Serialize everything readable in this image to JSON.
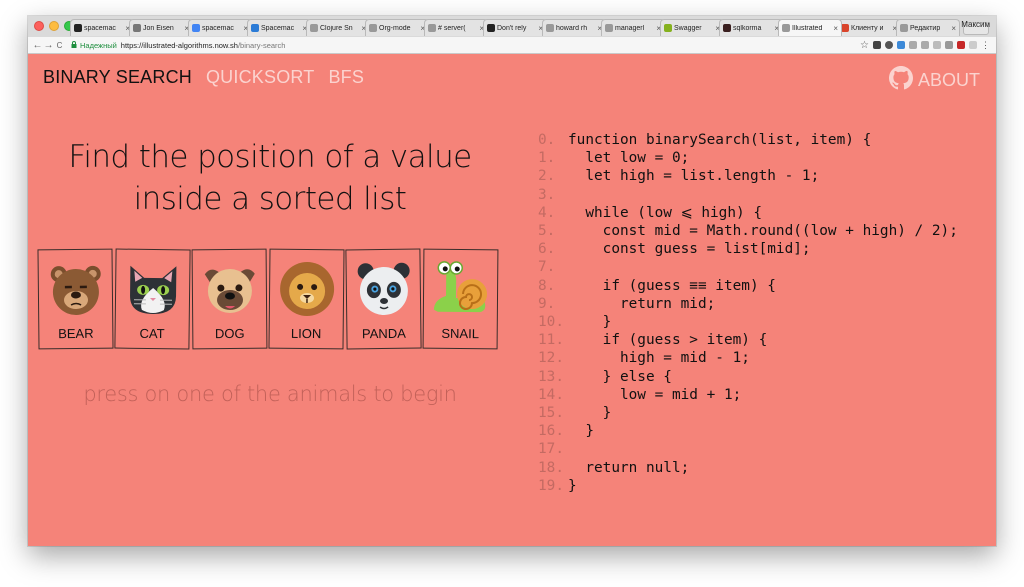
{
  "browser": {
    "tabs": [
      {
        "title": "spacemac",
        "favicon": "github-icon",
        "color": "#222222"
      },
      {
        "title": "Jon Eisen",
        "favicon": "jon-icon",
        "color": "#777777"
      },
      {
        "title": "spacemac",
        "favicon": "google-icon",
        "color": "#4285f4"
      },
      {
        "title": "Spacemac",
        "favicon": "s-icon",
        "color": "#2b7bd6"
      },
      {
        "title": "Clojure Sn",
        "favicon": "doc-icon",
        "color": "#999999"
      },
      {
        "title": "Org-mode",
        "favicon": "doc-icon",
        "color": "#999999"
      },
      {
        "title": "# server(",
        "favicon": "terminal-icon",
        "color": "#999999"
      },
      {
        "title": "Don't rely",
        "favicon": "github-icon",
        "color": "#222222"
      },
      {
        "title": "howard rh",
        "favicon": "page-icon",
        "color": "#999999"
      },
      {
        "title": "managerl",
        "favicon": "page-icon",
        "color": "#999999"
      },
      {
        "title": "Swagger",
        "favicon": "swagger-icon",
        "color": "#85b11e"
      },
      {
        "title": "sqlkorma",
        "favicon": "y-icon",
        "color": "#3a1f1f"
      },
      {
        "title": "Illustrated",
        "favicon": "page-icon",
        "color": "#999999",
        "active": true
      },
      {
        "title": "Клиенту и",
        "favicon": "k-icon",
        "color": "#d9442b"
      },
      {
        "title": "Редактир",
        "favicon": "page-icon",
        "color": "#999999"
      }
    ],
    "profile": "Максим",
    "back": "←",
    "forward": "→",
    "reload": "C",
    "secure_label": "Надежный",
    "url_host": "https://illustrated-algorithms.now.sh",
    "url_path": "/binary-search",
    "star": "☆"
  },
  "nav": {
    "items": [
      {
        "label": "BINARY SEARCH",
        "active": true
      },
      {
        "label": "QUICKSORT",
        "active": false
      },
      {
        "label": "BFS",
        "active": false
      }
    ],
    "about_label": "ABOUT"
  },
  "title_line1": "Find the position of a value",
  "title_line2": "inside a sorted list",
  "animals": [
    {
      "label": "BEAR",
      "icon": "bear-icon"
    },
    {
      "label": "CAT",
      "icon": "cat-icon"
    },
    {
      "label": "DOG",
      "icon": "dog-icon"
    },
    {
      "label": "LION",
      "icon": "lion-icon"
    },
    {
      "label": "PANDA",
      "icon": "panda-icon"
    },
    {
      "label": "SNAIL",
      "icon": "snail-icon"
    }
  ],
  "hint": "press on one of the animals to begin",
  "code_lines": [
    {
      "n": "0.",
      "text": "function binarySearch(list, item) {"
    },
    {
      "n": "1.",
      "text": "  let low = 0;"
    },
    {
      "n": "2.",
      "text": "  let high = list.length - 1;"
    },
    {
      "n": "3.",
      "text": ""
    },
    {
      "n": "4.",
      "text": "  while (low ⩽ high) {"
    },
    {
      "n": "5.",
      "text": "    const mid = Math.round((low + high) / 2);"
    },
    {
      "n": "6.",
      "text": "    const guess = list[mid];"
    },
    {
      "n": "7.",
      "text": ""
    },
    {
      "n": "8.",
      "text": "    if (guess ≡≡ item) {"
    },
    {
      "n": "9.",
      "text": "      return mid;"
    },
    {
      "n": "10.",
      "text": "    }"
    },
    {
      "n": "11.",
      "text": "    if (guess > item) {"
    },
    {
      "n": "12.",
      "text": "      high = mid - 1;"
    },
    {
      "n": "13.",
      "text": "    } else {"
    },
    {
      "n": "14.",
      "text": "      low = mid + 1;"
    },
    {
      "n": "15.",
      "text": "    }"
    },
    {
      "n": "16.",
      "text": "  }"
    },
    {
      "n": "17.",
      "text": ""
    },
    {
      "n": "18.",
      "text": "  return null;"
    },
    {
      "n": "19.",
      "text": "}"
    }
  ],
  "colors": {
    "page_bg": "#f58379",
    "nav_inactive": "#fbd3cf",
    "line_number": "#c46a62"
  }
}
